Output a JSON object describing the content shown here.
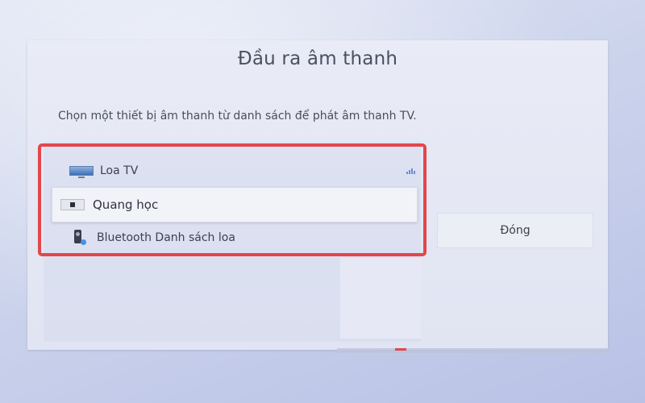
{
  "dialog": {
    "title": "Đầu ra âm thanh",
    "description": "Chọn một thiết bị âm thanh từ danh sách để phát âm thanh TV."
  },
  "devices": [
    {
      "label": "Loa TV",
      "icon": "tv-speaker-icon",
      "selected": false,
      "active": true
    },
    {
      "label": "Quang học",
      "icon": "optical-icon",
      "selected": true,
      "active": false
    },
    {
      "label": "Bluetooth Danh sách loa",
      "icon": "bluetooth-speaker-icon",
      "selected": false,
      "active": false
    }
  ],
  "buttons": {
    "close_label": "Đóng"
  },
  "colors": {
    "highlight": "#e2474c",
    "accent": "#6b8fd1"
  }
}
